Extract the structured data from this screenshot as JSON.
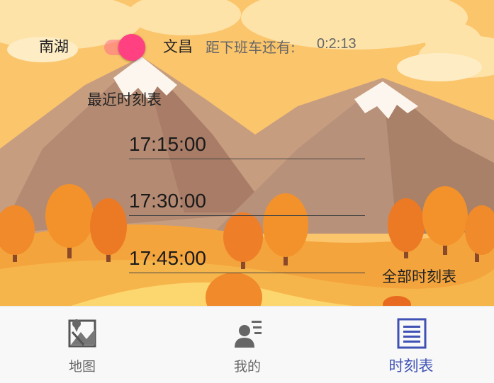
{
  "header": {
    "from_station": "南湖",
    "to_station": "文昌",
    "countdown_label": "距下班车还有:",
    "countdown_value": "0:2:13"
  },
  "schedule": {
    "title": "最近时刻表",
    "times": [
      "17:15:00",
      "17:30:00",
      "17:45:00"
    ],
    "all_link": "全部时刻表"
  },
  "nav": {
    "items": [
      {
        "label": "地图",
        "icon": "map-icon"
      },
      {
        "label": "我的",
        "icon": "profile-icon"
      },
      {
        "label": "时刻表",
        "icon": "schedule-icon"
      }
    ],
    "active_index": 2
  },
  "colors": {
    "accent": "#ff4081",
    "active_nav": "#3f51b5",
    "sky": "#fbc56c"
  }
}
